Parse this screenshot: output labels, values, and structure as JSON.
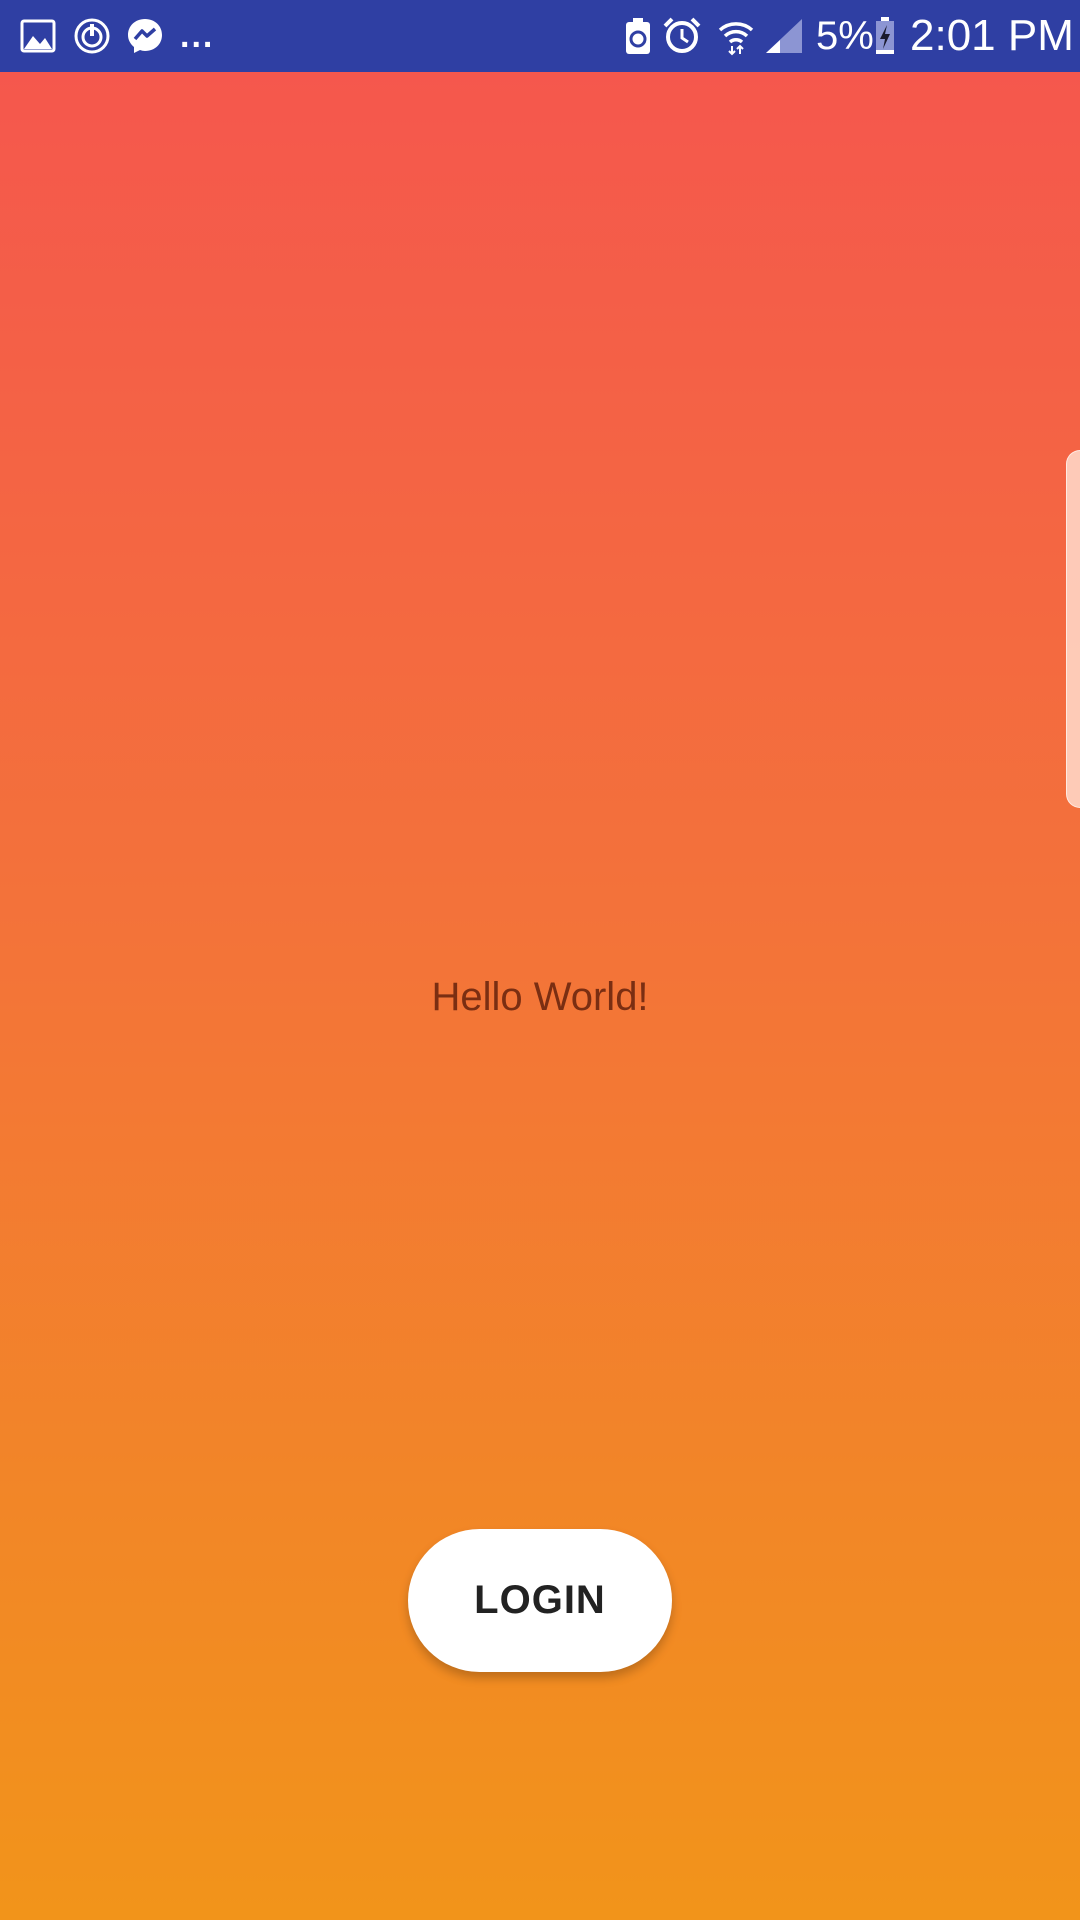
{
  "status_bar": {
    "background": "#2f3fa3",
    "notification_icons": [
      "gallery-icon",
      "sync-icon",
      "messenger-icon"
    ],
    "more_indicator": "...",
    "system_icons": [
      "battery-saver-icon",
      "alarm-icon",
      "wifi-icon",
      "signal-icon"
    ],
    "battery_percent": "5%",
    "time": "2:01 PM"
  },
  "main": {
    "greeting": "Hello World!",
    "login_label": "LOGIN",
    "gradient": {
      "top": "#f5574d",
      "bottom": "#f2941a"
    }
  }
}
